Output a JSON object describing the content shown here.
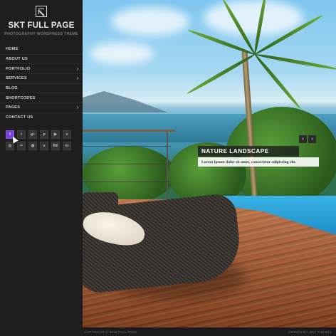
{
  "site": {
    "title": "SKT FULL PAGE",
    "tagline": "PHOTOGRAPHY WORDPRESS THEME"
  },
  "nav": [
    {
      "label": "HOME",
      "has_submenu": false
    },
    {
      "label": "ABOUT US",
      "has_submenu": false
    },
    {
      "label": "PORTFOLIO",
      "has_submenu": true
    },
    {
      "label": "SERVICES",
      "has_submenu": true
    },
    {
      "label": "BLOG",
      "has_submenu": false
    },
    {
      "label": "SHORTCODES",
      "has_submenu": false
    },
    {
      "label": "PAGES",
      "has_submenu": true
    },
    {
      "label": "CONTACT US",
      "has_submenu": false
    }
  ],
  "social": [
    {
      "icon": "facebook-icon",
      "glyph": "f",
      "active": true
    },
    {
      "icon": "twitter-icon",
      "glyph": "t",
      "active": false
    },
    {
      "icon": "google-plus-icon",
      "glyph": "g+",
      "active": false
    },
    {
      "icon": "pinterest-icon",
      "glyph": "p",
      "active": false
    },
    {
      "icon": "youtube-icon",
      "glyph": "▶",
      "active": false
    },
    {
      "icon": "vimeo-icon",
      "glyph": "v",
      "active": false
    },
    {
      "icon": "instagram-icon",
      "glyph": "◎",
      "active": false
    },
    {
      "icon": "flickr-icon",
      "glyph": "••",
      "active": false
    },
    {
      "icon": "dribbble-icon",
      "glyph": "◍",
      "active": false
    },
    {
      "icon": "skype-icon",
      "glyph": "s",
      "active": false
    },
    {
      "icon": "behance-icon",
      "glyph": "Bē",
      "active": false
    },
    {
      "icon": "linkedin-icon",
      "glyph": "in",
      "active": false
    }
  ],
  "slider": {
    "title": "NATURE LANDSCAPE",
    "text": "Lorem Ipsum dolor sit amet, consectetur adipiscing elit.",
    "prev_glyph": "‹",
    "next_glyph": "›"
  },
  "footer": {
    "copyright": "COPYRIGHT © 2016 FULL PAGE",
    "credit": "DESIGN BY: SKT THEMES"
  },
  "colors": {
    "accent": "#7a3fe0",
    "sidebar_bg": "#1e1e1e"
  }
}
